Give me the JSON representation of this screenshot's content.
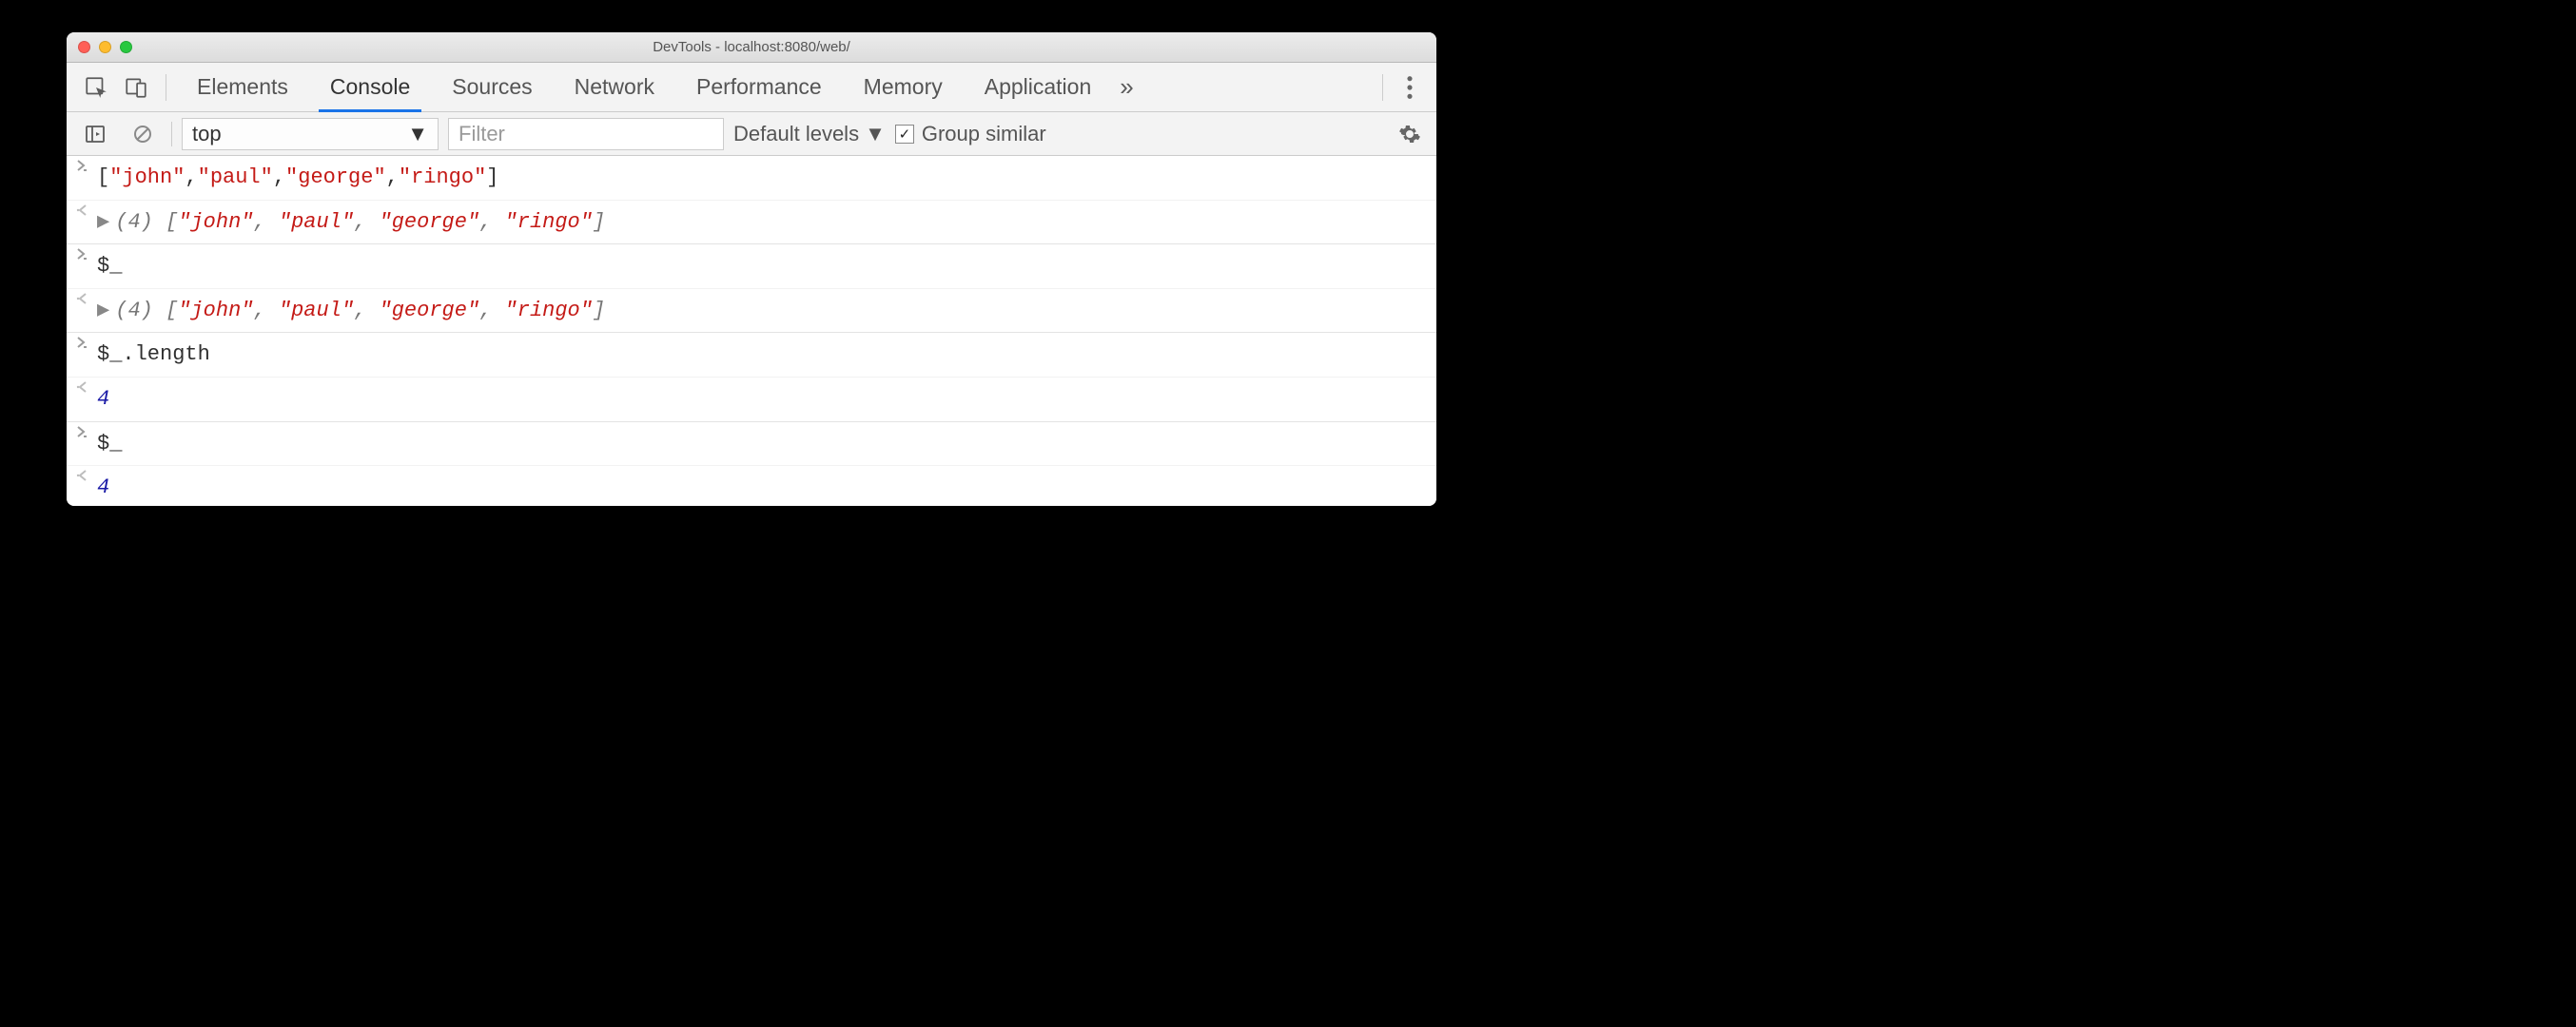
{
  "window": {
    "title": "DevTools - localhost:8080/web/"
  },
  "tabs": {
    "items": [
      "Elements",
      "Console",
      "Sources",
      "Network",
      "Performance",
      "Memory",
      "Application"
    ],
    "active_index": 1,
    "overflow_glyph": "»"
  },
  "toolbar": {
    "context_value": "top",
    "filter_placeholder": "Filter",
    "levels_label": "Default levels",
    "group_similar_label": "Group similar",
    "group_similar_checked": true
  },
  "console": {
    "rows": [
      {
        "kind": "input",
        "segments": [
          {
            "t": "[",
            "c": "plain"
          },
          {
            "t": "\"john\"",
            "c": "str"
          },
          {
            "t": ",",
            "c": "plain"
          },
          {
            "t": "\"paul\"",
            "c": "str"
          },
          {
            "t": ",",
            "c": "plain"
          },
          {
            "t": "\"george\"",
            "c": "str"
          },
          {
            "t": ",",
            "c": "plain"
          },
          {
            "t": "\"ringo\"",
            "c": "str"
          },
          {
            "t": "]",
            "c": "plain"
          }
        ]
      },
      {
        "kind": "output",
        "expandable": true,
        "group_end": true,
        "segments": [
          {
            "t": "(4) ",
            "c": "count"
          },
          {
            "t": "[",
            "c": "brkt"
          },
          {
            "t": "\"john\"",
            "c": "str"
          },
          {
            "t": ", ",
            "c": "brkt"
          },
          {
            "t": "\"paul\"",
            "c": "str"
          },
          {
            "t": ", ",
            "c": "brkt"
          },
          {
            "t": "\"george\"",
            "c": "str"
          },
          {
            "t": ", ",
            "c": "brkt"
          },
          {
            "t": "\"ringo\"",
            "c": "str"
          },
          {
            "t": "]",
            "c": "brkt"
          }
        ]
      },
      {
        "kind": "input",
        "segments": [
          {
            "t": "$_",
            "c": "plain"
          }
        ]
      },
      {
        "kind": "output",
        "expandable": true,
        "group_end": true,
        "segments": [
          {
            "t": "(4) ",
            "c": "count"
          },
          {
            "t": "[",
            "c": "brkt"
          },
          {
            "t": "\"john\"",
            "c": "str"
          },
          {
            "t": ", ",
            "c": "brkt"
          },
          {
            "t": "\"paul\"",
            "c": "str"
          },
          {
            "t": ", ",
            "c": "brkt"
          },
          {
            "t": "\"george\"",
            "c": "str"
          },
          {
            "t": ", ",
            "c": "brkt"
          },
          {
            "t": "\"ringo\"",
            "c": "str"
          },
          {
            "t": "]",
            "c": "brkt"
          }
        ]
      },
      {
        "kind": "input",
        "segments": [
          {
            "t": "$_.length",
            "c": "plain"
          }
        ]
      },
      {
        "kind": "output",
        "group_end": true,
        "segments": [
          {
            "t": "4",
            "c": "num"
          }
        ]
      },
      {
        "kind": "input",
        "segments": [
          {
            "t": "$_",
            "c": "plain"
          }
        ]
      },
      {
        "kind": "output",
        "group_end": true,
        "segments": [
          {
            "t": "4",
            "c": "num"
          }
        ]
      },
      {
        "kind": "prompt"
      }
    ]
  }
}
